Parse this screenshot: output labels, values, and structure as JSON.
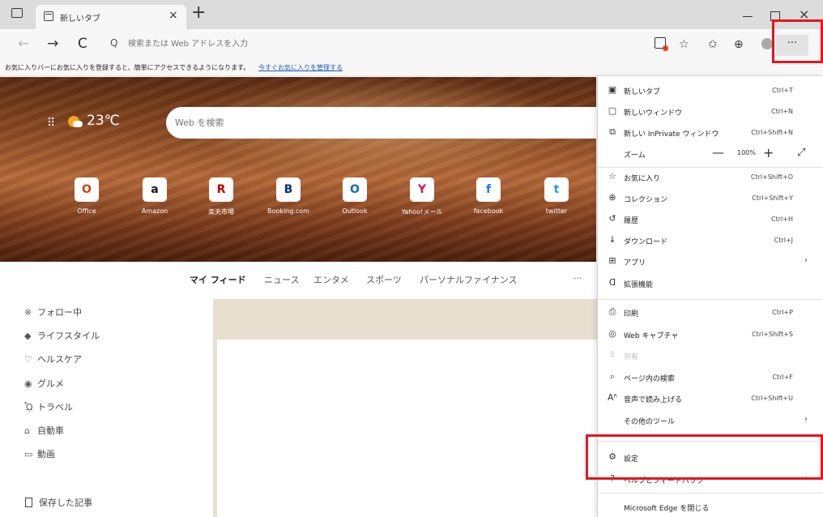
{
  "tabstrip": {
    "tab_title": "新しいタブ",
    "tab_close": "×",
    "new_tab": "+",
    "minimize": "",
    "maximize": "",
    "close": "×"
  },
  "navbar": {
    "back": "←",
    "forward": "→",
    "refresh": "C",
    "search_glyph": "Q",
    "address_placeholder": "検索または Web アドレスを入力",
    "more": "···"
  },
  "favorites_bar": {
    "message": "お気に入りバーにお気に入りを登録すると、簡単にアクセスできるようになります。",
    "link": "今すぐお気に入りを管理する"
  },
  "hero": {
    "weather": "23℃",
    "search_placeholder": "Web を検索",
    "tiles": [
      {
        "label": "Office",
        "glyph": "O",
        "color": "#d83b01"
      },
      {
        "label": "Amazon",
        "glyph": "a",
        "color": "#111111"
      },
      {
        "label": "楽天市場",
        "glyph": "R",
        "color": "#bf0000"
      },
      {
        "label": "Booking.com",
        "glyph": "B",
        "color": "#003580"
      },
      {
        "label": "Outlook",
        "glyph": "O",
        "color": "#0f6cbd"
      },
      {
        "label": "Yahoo!メール",
        "glyph": "Y",
        "color": "#d4145a"
      },
      {
        "label": "facebook",
        "glyph": "f",
        "color": "#1877f2"
      },
      {
        "label": "twitter",
        "glyph": "t",
        "color": "#1d9bf0"
      }
    ]
  },
  "feed": {
    "tabs": [
      "マイ フィード",
      "ニュース",
      "エンタメ",
      "スポーツ",
      "パーソナルファイナンス",
      "···"
    ]
  },
  "sidebar": {
    "items": [
      {
        "label": "フォロー中",
        "icon": "※"
      },
      {
        "label": "ライフスタイル",
        "icon": "◆"
      },
      {
        "label": "ヘルスケア",
        "icon": "♡"
      },
      {
        "label": "グルメ",
        "icon": "◉"
      },
      {
        "label": "トラベル",
        "icon": "ᾯ"
      },
      {
        "label": "自動車",
        "icon": "⌂"
      },
      {
        "label": "動画",
        "icon": "▭"
      }
    ],
    "saved": "保存した記事"
  },
  "menu": {
    "items": [
      {
        "icon": "▣",
        "label": "新しいタブ",
        "shortcut": "Ctrl+T"
      },
      {
        "icon": "▢",
        "label": "新しいウィンドウ",
        "shortcut": "Ctrl+N"
      },
      {
        "icon": "⧉",
        "label": "新しい InPrivate ウィンドウ",
        "shortcut": "Ctrl+Shift+N"
      },
      {
        "icon": "",
        "label": "ズーム",
        "shortcut": ""
      },
      {
        "icon": "☆",
        "label": "お気に入り",
        "shortcut": "Ctrl+Shift+O"
      },
      {
        "icon": "⊕",
        "label": "コレクション",
        "shortcut": "Ctrl+Shift+Y"
      },
      {
        "icon": "↺",
        "label": "履歴",
        "shortcut": "Ctrl+H"
      },
      {
        "icon": "↓",
        "label": "ダウンロード",
        "shortcut": "Ctrl+J"
      },
      {
        "icon": "⊞",
        "label": "アプリ",
        "shortcut": ""
      },
      {
        "icon": "ᗡ",
        "label": "拡張機能",
        "shortcut": ""
      },
      {
        "icon": "⎙",
        "label": "印刷",
        "shortcut": "Ctrl+P"
      },
      {
        "icon": "◎",
        "label": "Web キャプチャ",
        "shortcut": "Ctrl+Shift+S"
      },
      {
        "icon": "⇪",
        "label": "共有",
        "shortcut": ""
      },
      {
        "icon": "⌕",
        "label": "ページ内の検索",
        "shortcut": "Ctrl+F"
      },
      {
        "icon": "Aʱ",
        "label": "音声で読み上げる",
        "shortcut": "Ctrl+Shift+U"
      },
      {
        "icon": "",
        "label": "その他のツール",
        "shortcut": ""
      },
      {
        "icon": "⚙",
        "label": "設定",
        "shortcut": ""
      },
      {
        "icon": "?",
        "label": "ヘルプとフィードバック",
        "shortcut": ""
      },
      {
        "icon": "",
        "label": "Microsoft Edge を閉じる",
        "shortcut": ""
      }
    ],
    "zoom": {
      "minus": "—",
      "value": "100%",
      "plus": "+",
      "fullscreen": "⤢"
    },
    "submenu_arrow": "›"
  },
  "highlights": {
    "color": "#e8141c"
  }
}
